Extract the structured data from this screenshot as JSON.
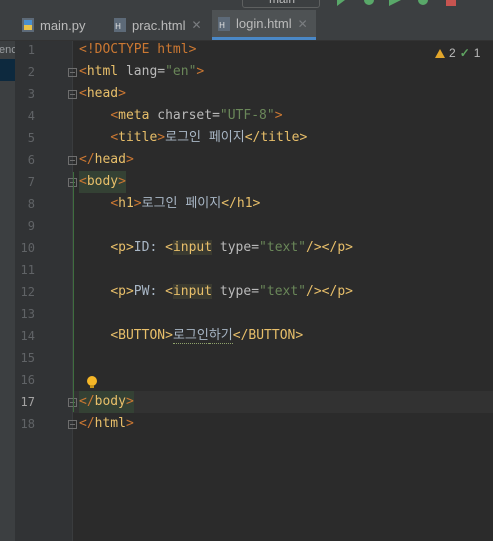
{
  "toolbar": {
    "run_config_label": "main"
  },
  "tabs": [
    {
      "label": "main.py",
      "icon": "python-file-icon",
      "active": false,
      "closable": false
    },
    {
      "label": "prac.html",
      "icon": "html-file-icon",
      "active": false,
      "closable": true
    },
    {
      "label": "login.html",
      "icon": "html-file-icon",
      "active": true,
      "closable": true
    }
  ],
  "left_panel": {
    "fragment": "enc"
  },
  "inspections": {
    "warnings": "2",
    "ok": "1"
  },
  "line_numbers": [
    "1",
    "2",
    "3",
    "4",
    "5",
    "6",
    "7",
    "8",
    "9",
    "10",
    "11",
    "12",
    "13",
    "14",
    "15",
    "16",
    "17",
    "18"
  ],
  "current_line": "17",
  "code": {
    "l1": {
      "a": "<!DOCTYPE html>"
    },
    "l2": {
      "open": "<",
      "tag": "html",
      "attr": " lang=",
      "val": "\"en\"",
      "close": ">"
    },
    "l3": {
      "open": "<",
      "tag": "head",
      "close": ">"
    },
    "l4": {
      "indent": "    ",
      "open": "<",
      "tag": "meta",
      "attr": " charset=",
      "val": "\"UTF-8\"",
      "close": ">"
    },
    "l5": {
      "indent": "    ",
      "open": "<",
      "tag": "title",
      "close": ">",
      "text": "로그인 페이지",
      "end": "</title>"
    },
    "l6": {
      "open": "</",
      "tag": "head",
      "close": ">"
    },
    "l7": {
      "open": "<",
      "tag": "body",
      "close": ">"
    },
    "l8": {
      "indent": "    ",
      "open": "<",
      "tag": "h1",
      "close": ">",
      "text": "로그인 페이지",
      "end": "</h1>"
    },
    "l10": {
      "indent": "    ",
      "p_open": "<p>",
      "text": "ID: ",
      "lt": "<",
      "tag": "input",
      "attr": " type=",
      "val": "\"text\"",
      "self": "/>",
      "end": "</p>"
    },
    "l12": {
      "indent": "    ",
      "p_open": "<p>",
      "text": "PW: ",
      "lt": "<",
      "tag": "input",
      "attr": " type=",
      "val": "\"text\"",
      "self": "/>",
      "end": "</p>"
    },
    "l14": {
      "indent": "    ",
      "open": "<BUTTON>",
      "text1": "로그인",
      "text2": "하기",
      "end": "</BUTTON>"
    },
    "l17": {
      "open": "</",
      "tag": "body",
      "close": ">"
    },
    "l18": {
      "open": "</",
      "tag": "html",
      "close": ">"
    }
  },
  "colors": {
    "tag": "#e8bf6a",
    "string": "#6a8759",
    "text": "#a9b7c6",
    "background": "#2b2b2b",
    "active_tab_underline": "#4a88c7"
  }
}
